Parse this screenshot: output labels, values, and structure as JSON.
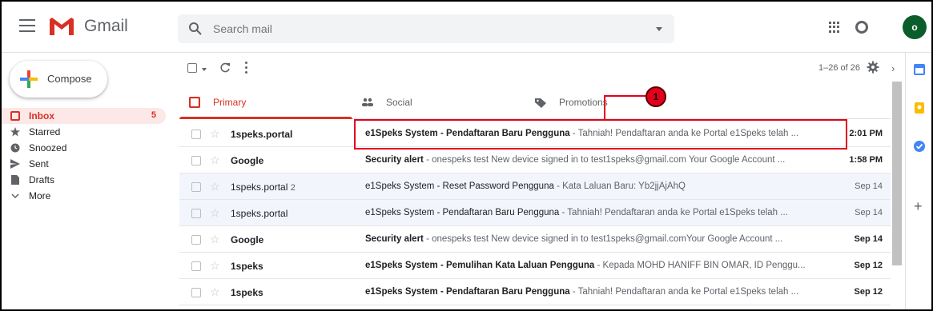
{
  "header": {
    "app_name": "Gmail",
    "search_placeholder": "Search mail",
    "avatar_initial": "o"
  },
  "sidebar": {
    "compose_label": "Compose",
    "items": [
      {
        "label": "Inbox",
        "count": "5",
        "icon": "inbox-icon",
        "active": true
      },
      {
        "label": "Starred",
        "count": "",
        "icon": "star-icon"
      },
      {
        "label": "Snoozed",
        "count": "",
        "icon": "clock-icon"
      },
      {
        "label": "Sent",
        "count": "",
        "icon": "send-icon"
      },
      {
        "label": "Drafts",
        "count": "",
        "icon": "draft-icon"
      },
      {
        "label": "More",
        "count": "",
        "icon": "chevron-down-icon"
      }
    ]
  },
  "toolbar": {
    "page_info": "1–26 of 26",
    "prev": "‹",
    "next": "›"
  },
  "tabs": [
    {
      "label": "Primary",
      "icon": "inbox-icon",
      "active": true
    },
    {
      "label": "Social",
      "icon": "people-icon"
    },
    {
      "label": "Promotions",
      "icon": "tag-icon"
    }
  ],
  "emails": [
    {
      "sender": "1speks.portal",
      "count": "",
      "subject": "e1Speks System - Pendaftaran Baru Pengguna",
      "snippet": " - Tahniah! Pendaftaran anda ke Portal e1Speks telah ...",
      "date": "2:01 PM",
      "unread": true
    },
    {
      "sender": "Google",
      "count": "",
      "subject": "Security alert",
      "snippet": " - onespeks test New device signed in to test1speks@gmail.com Your Google Account ...",
      "date": "1:58 PM",
      "unread": true
    },
    {
      "sender": "1speks.portal",
      "count": "2",
      "subject": "e1Speks System - Reset Password Pengguna",
      "snippet": " - Kata Laluan Baru: Yb2jjAjAhQ",
      "date": "Sep 14",
      "unread": false
    },
    {
      "sender": "1speks.portal",
      "count": "",
      "subject": "e1Speks System - Pendaftaran Baru Pengguna",
      "snippet": " - Tahniah! Pendaftaran anda ke Portal e1Speks telah ...",
      "date": "Sep 14",
      "unread": false
    },
    {
      "sender": "Google",
      "count": "",
      "subject": "Security alert",
      "snippet": " - onespeks test New device signed in to test1speks@gmail.comYour Google Account ...",
      "date": "Sep 14",
      "unread": true
    },
    {
      "sender": "1speks",
      "count": "",
      "subject": "e1Speks System - Pemulihan Kata Laluan Pengguna",
      "snippet": " - Kepada MOHD HANIFF BIN OMAR, ID Penggu...",
      "date": "Sep 12",
      "unread": true
    },
    {
      "sender": "1speks",
      "count": "",
      "subject": "e1Speks System - Pendaftaran Baru Pengguna",
      "snippet": " - Tahniah! Pendaftaran anda ke Portal e1Speks telah ...",
      "date": "Sep 12",
      "unread": true
    }
  ],
  "annotation": {
    "number": "1",
    "color": "#e3001b"
  },
  "colors": {
    "accent": "#d93025",
    "avatar": "#0b5e2b"
  }
}
